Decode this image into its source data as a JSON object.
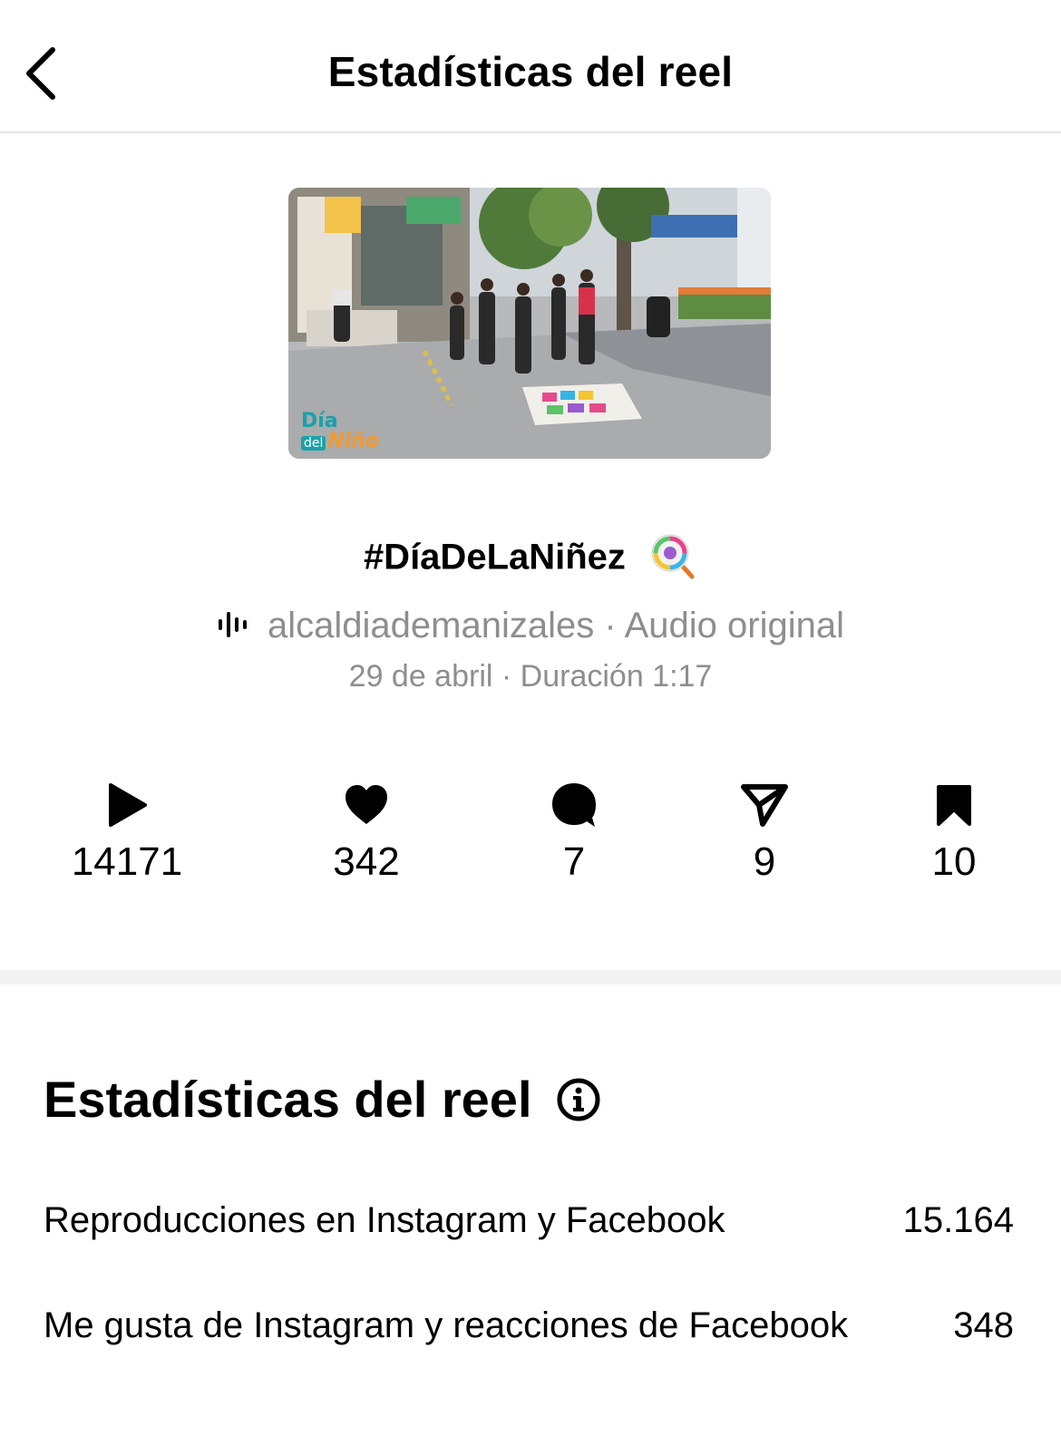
{
  "header": {
    "title": "Estadísticas del reel"
  },
  "reel": {
    "thumbnail": {
      "logo_line1": "Día",
      "logo_line2a": "del",
      "logo_line2b": "Niño"
    },
    "caption": "#DíaDeLaNiñez",
    "caption_emoji": "lollipop-emoji",
    "audio": {
      "account": "alcaldiademanizales",
      "separator": " · ",
      "label": "Audio original"
    },
    "meta": {
      "date": "29 de abril",
      "separator": " · ",
      "duration": "Duración 1:17"
    }
  },
  "stats": [
    {
      "icon": "play-icon",
      "value": "14171"
    },
    {
      "icon": "heart-icon",
      "value": "342"
    },
    {
      "icon": "comment-icon",
      "value": "7"
    },
    {
      "icon": "share-icon",
      "value": "9"
    },
    {
      "icon": "save-icon",
      "value": "10"
    }
  ],
  "insights": {
    "title": "Estadísticas del reel",
    "rows": [
      {
        "label": "Reproducciones en Instagram y Facebook",
        "value": "15.164"
      },
      {
        "label": "Me gusta de Instagram y reacciones de Facebook",
        "value": "348"
      }
    ]
  }
}
